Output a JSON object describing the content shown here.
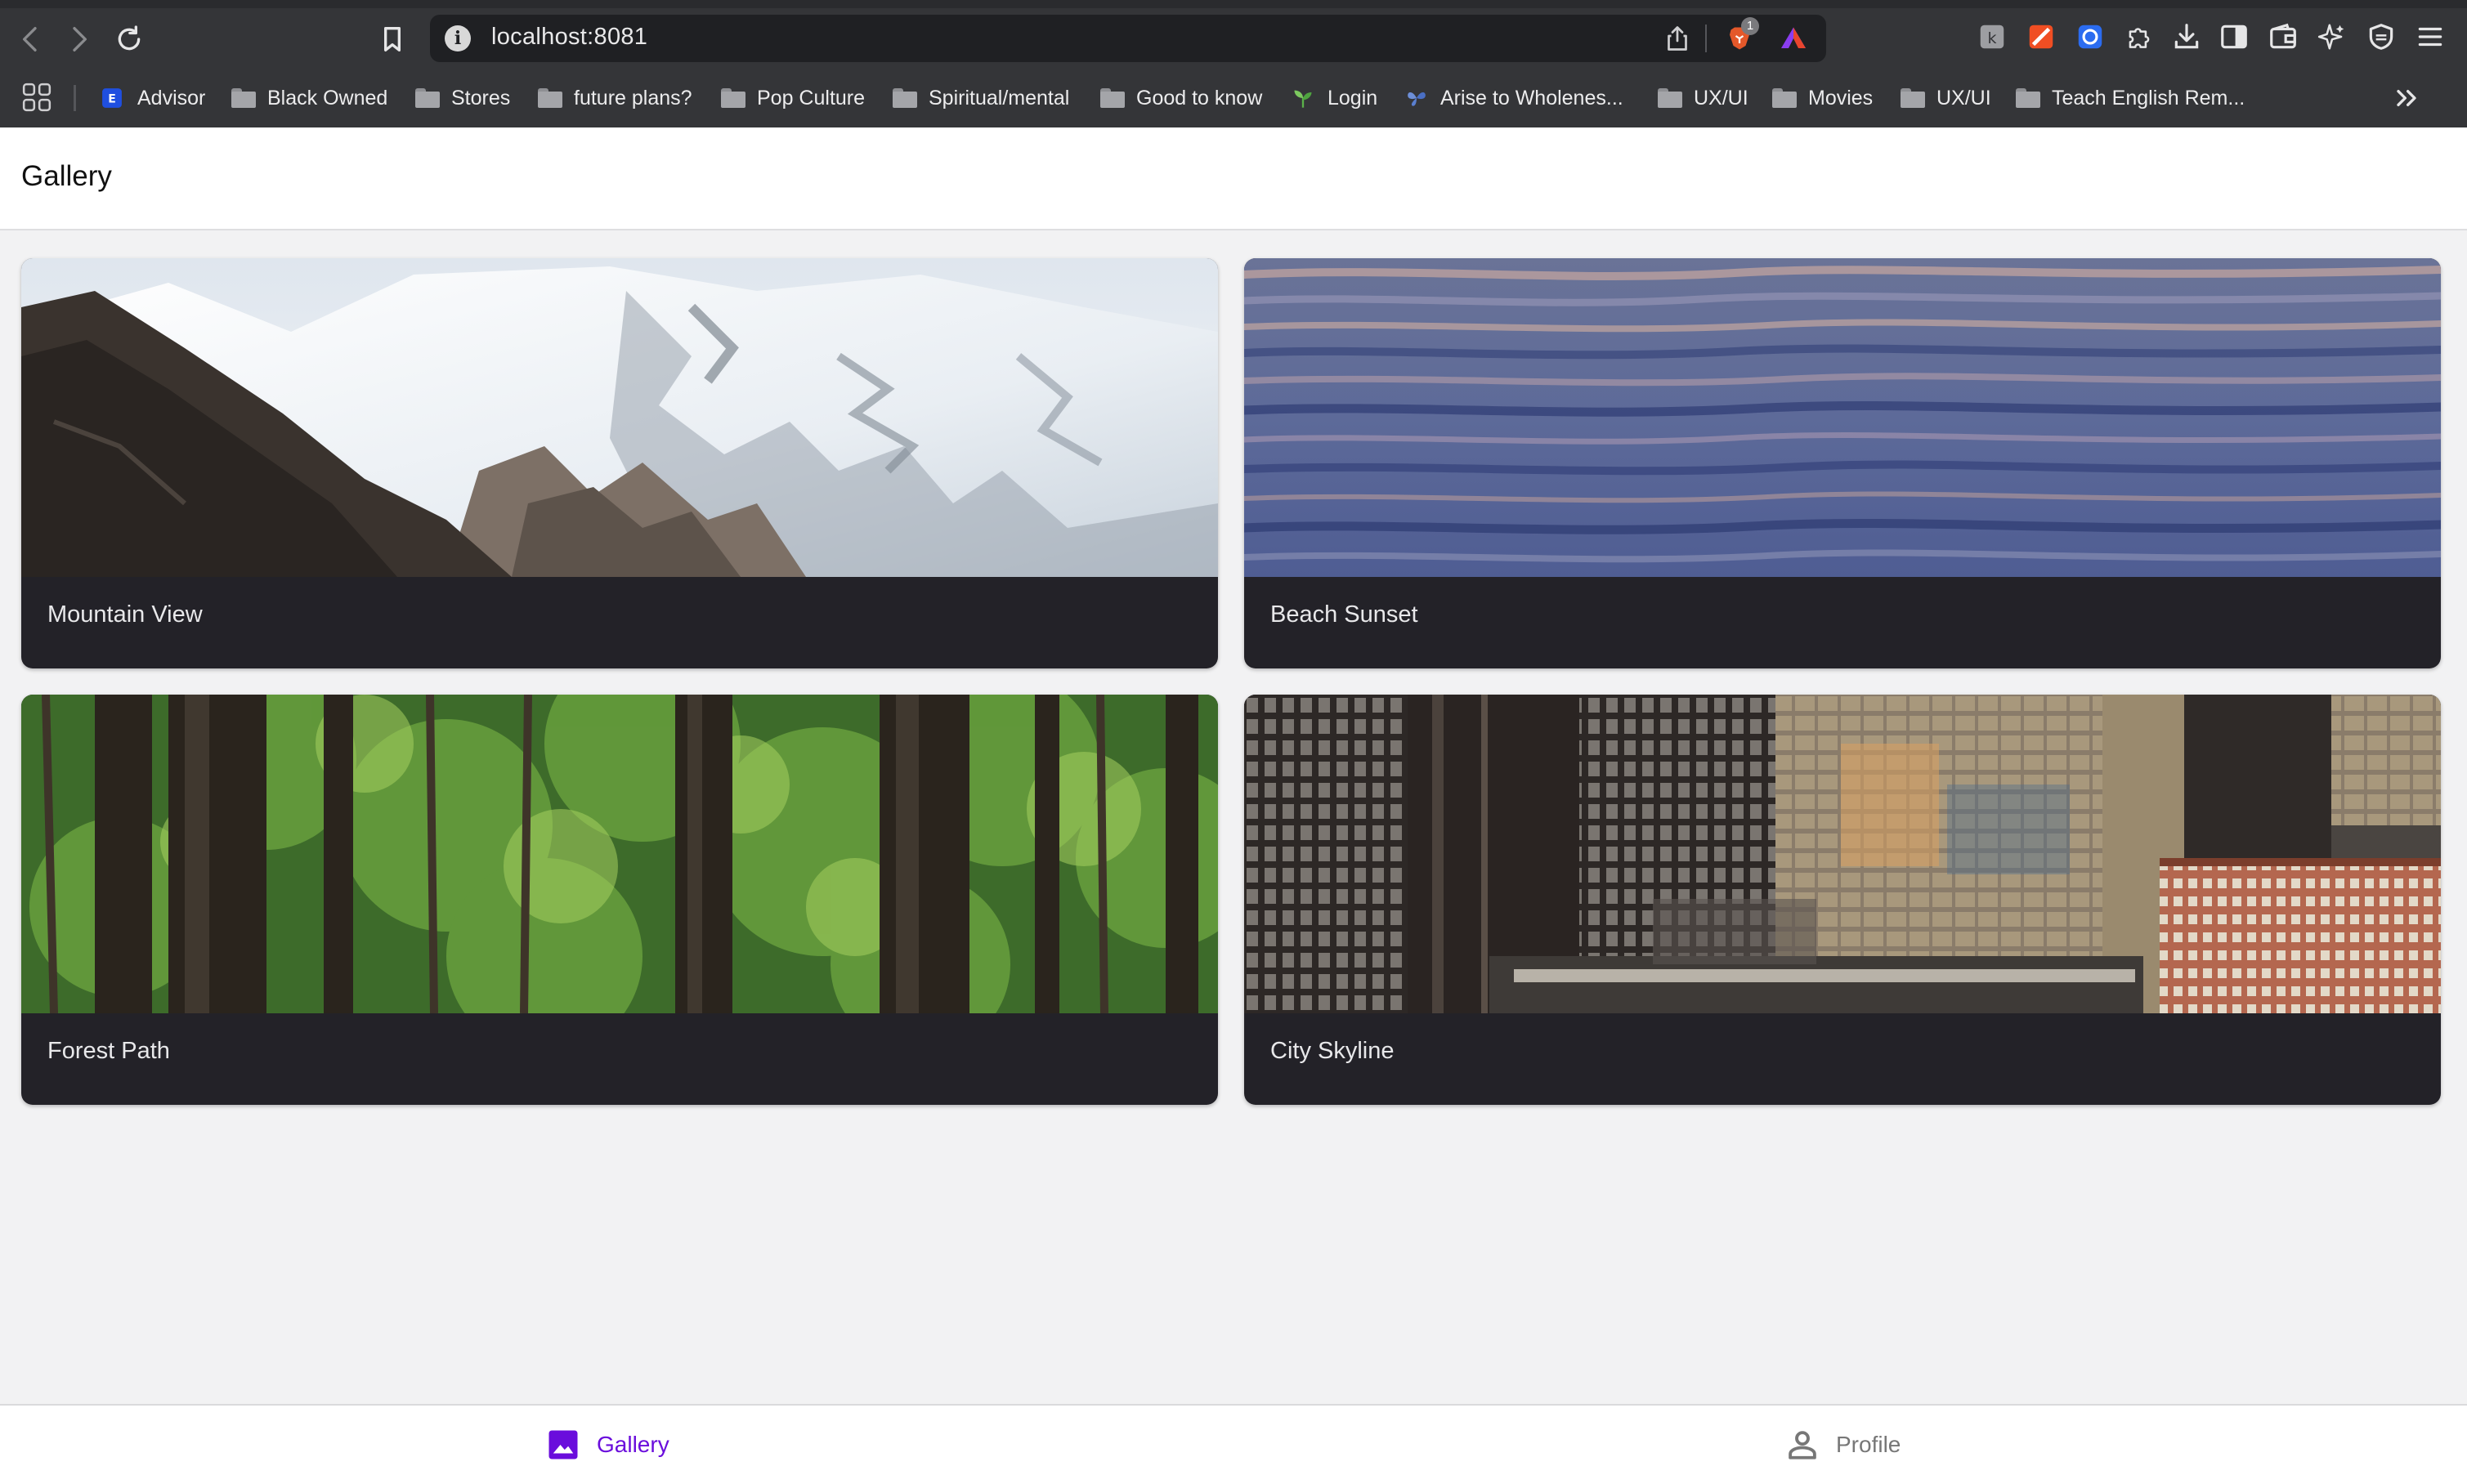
{
  "browser": {
    "url": "localhost:8081",
    "shields_count": "1",
    "bookmarks": [
      {
        "label": "Advisor",
        "icon": "e-badge-icon"
      },
      {
        "label": "Black Owned",
        "icon": "folder-icon"
      },
      {
        "label": "Stores",
        "icon": "folder-icon"
      },
      {
        "label": "future plans?",
        "icon": "folder-icon"
      },
      {
        "label": "Pop Culture",
        "icon": "folder-icon"
      },
      {
        "label": "Spiritual/mental",
        "icon": "folder-icon"
      },
      {
        "label": "Good to know",
        "icon": "folder-icon"
      },
      {
        "label": "Login",
        "icon": "sprout-icon"
      },
      {
        "label": "Arise to Wholenes...",
        "icon": "butterfly-icon"
      },
      {
        "label": "UX/UI",
        "icon": "folder-icon"
      },
      {
        "label": "Movies",
        "icon": "folder-icon"
      },
      {
        "label": "UX/UI",
        "icon": "folder-icon"
      },
      {
        "label": "Teach English Rem...",
        "icon": "folder-icon"
      }
    ]
  },
  "app": {
    "title": "Gallery",
    "cards": [
      {
        "title": "Mountain View",
        "image": "snowy-mountain-photo"
      },
      {
        "title": "Beach Sunset",
        "image": "ocean-water-photo"
      },
      {
        "title": "Forest Path",
        "image": "forest-trees-photo"
      },
      {
        "title": "City Skyline",
        "image": "city-buildings-photo"
      }
    ],
    "tabs": [
      {
        "label": "Gallery",
        "icon": "image-icon",
        "active": true
      },
      {
        "label": "Profile",
        "icon": "person-icon",
        "active": false
      }
    ]
  },
  "colors": {
    "accent": "#6a0ddc",
    "inactive_tab": "#777777",
    "card_background": "#232228",
    "chrome_background": "#343538"
  }
}
